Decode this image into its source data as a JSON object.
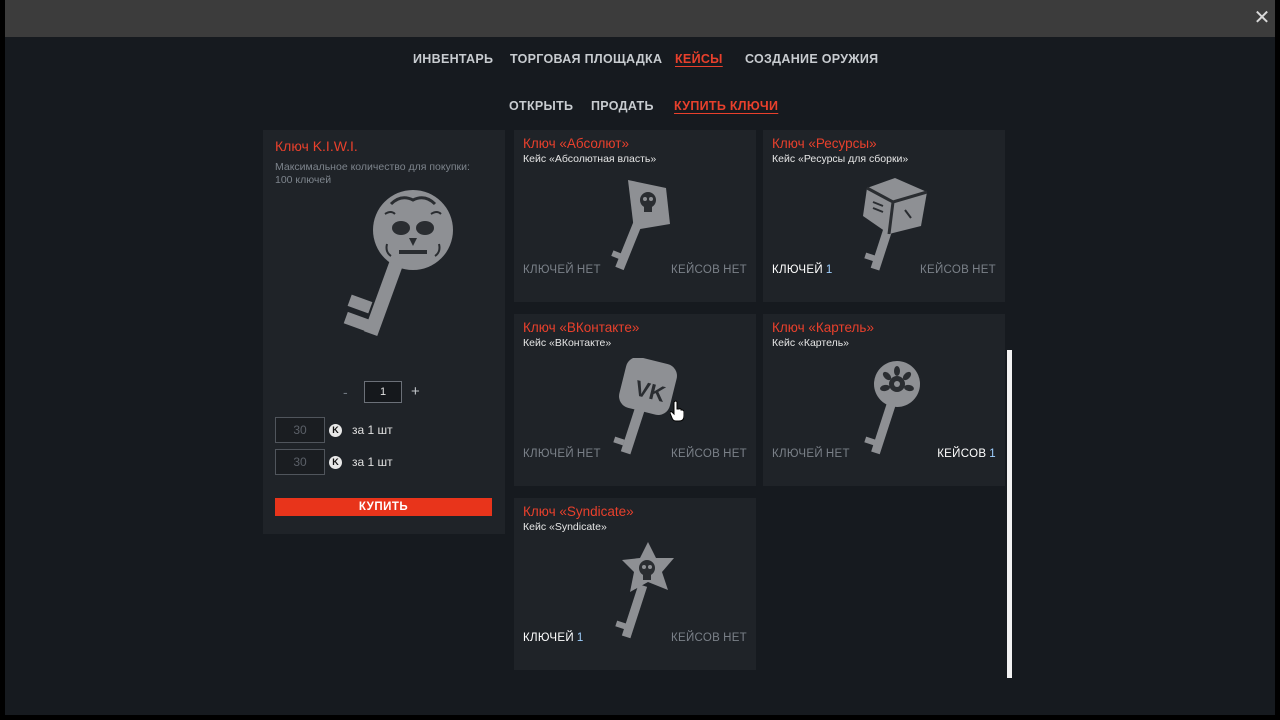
{
  "window": {
    "close_glyph": "✕"
  },
  "nav": {
    "tabs": [
      {
        "label": "ИНВЕНТАРЬ",
        "active": false
      },
      {
        "label": "ТОРГОВАЯ ПЛОЩАДКА",
        "active": false
      },
      {
        "label": "КЕЙСЫ",
        "active": true
      },
      {
        "label": "СОЗДАНИЕ ОРУЖИЯ",
        "active": false
      }
    ]
  },
  "subnav": {
    "tabs": [
      {
        "label": "ОТКРЫТЬ",
        "active": false
      },
      {
        "label": "ПРОДАТЬ",
        "active": false
      },
      {
        "label": "КУПИТЬ КЛЮЧИ",
        "active": true
      }
    ]
  },
  "purchase": {
    "title": "Ключ K.I.W.I.",
    "description": "Максимальное количество для покупки: 100 ключей",
    "qty_minus": "-",
    "quantity": "1",
    "qty_plus": "+",
    "prices": [
      {
        "value": "30",
        "currency_icon": "K",
        "unit": "за 1 шт"
      },
      {
        "value": "30",
        "currency_icon": "K",
        "unit": "за 1 шт"
      }
    ],
    "buy_label": "КУПИТЬ"
  },
  "keys": [
    {
      "title": "Ключ «Абсолют»",
      "case": "Кейс «Абсолютная власть»",
      "icon": "skull-flag-key-icon",
      "keys_label": "КЛЮЧЕЙ",
      "keys_value": "НЕТ",
      "cases_label": "КЕЙСОВ",
      "cases_value": "НЕТ"
    },
    {
      "title": "Ключ «Ресурсы»",
      "case": "Кейс «Ресурсы для сборки»",
      "icon": "cube-key-icon",
      "keys_label": "КЛЮЧЕЙ",
      "keys_value": "1",
      "cases_label": "КЕЙСОВ",
      "cases_value": "НЕТ"
    },
    {
      "title": "Ключ «ВКонтакте»",
      "case": "Кейс «ВКонтакте»",
      "icon": "vk-key-icon",
      "keys_label": "КЛЮЧЕЙ",
      "keys_value": "НЕТ",
      "cases_label": "КЕЙСОВ",
      "cases_value": "НЕТ"
    },
    {
      "title": "Ключ «Картель»",
      "case": "Кейс «Картель»",
      "icon": "lotus-key-icon",
      "keys_label": "КЛЮЧЕЙ",
      "keys_value": "НЕТ",
      "cases_label": "КЕЙСОВ",
      "cases_value": "1"
    },
    {
      "title": "Ключ «Syndicate»",
      "case": "Кейс «Syndicate»",
      "icon": "star-skull-key-icon",
      "keys_label": "КЛЮЧЕЙ",
      "keys_value": "1",
      "cases_label": "КЕЙСОВ",
      "cases_value": "НЕТ"
    }
  ],
  "colors": {
    "accent": "#e8402c",
    "buy_button": "#e8341b",
    "panel": "#1f2328",
    "background": "#161a1f"
  }
}
